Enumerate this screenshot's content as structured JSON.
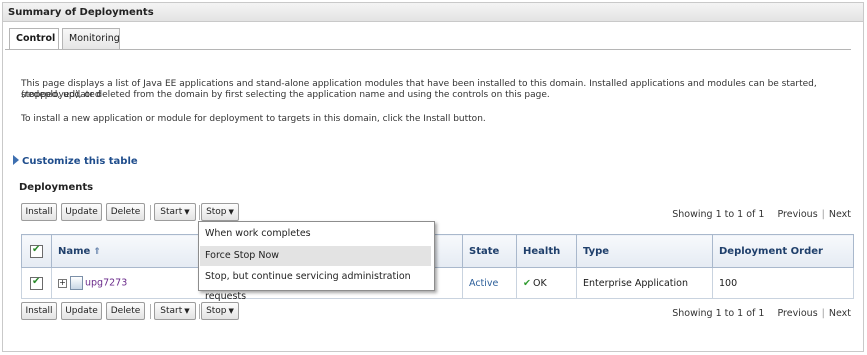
{
  "header": {
    "title": "Summary of Deployments"
  },
  "tabs": [
    {
      "label": "Control"
    },
    {
      "label": "Monitoring"
    }
  ],
  "intro": {
    "line1": "This page displays a list of Java EE applications and stand-alone application modules that have been installed to this domain. Installed applications and modules can be started, stopped, updated",
    "line2": "(redeployed), or deleted from the domain by first selecting the application name and using the controls on this page.",
    "line3": "To install a new application or module for deployment to targets in this domain, click the Install button."
  },
  "customize_label": "Customize this table",
  "section_title": "Deployments",
  "toolbar": {
    "install": "Install",
    "update": "Update",
    "delete": "Delete",
    "start": "Start",
    "stop": "Stop"
  },
  "pager": {
    "summary": "Showing 1 to 1 of 1",
    "previous": "Previous",
    "next": "Next"
  },
  "table": {
    "columns": [
      "Name",
      "State",
      "Health",
      "Type",
      "Deployment Order"
    ],
    "rows": [
      {
        "name": "upg7273",
        "state": "Active",
        "health": "OK",
        "type": "Enterprise Application",
        "order": "100"
      }
    ]
  },
  "stop_menu": {
    "items": [
      "When work completes",
      "Force Stop Now",
      "Stop, but continue servicing administration requests"
    ],
    "highlighted": "Force Stop Now"
  },
  "icons": [
    "expand-triangle-icon",
    "sort-ascending-icon",
    "checkbox-checked-icon",
    "tree-expand-icon",
    "application-icon",
    "ok-checkmark-icon",
    "dropdown-caret-icon"
  ],
  "colors": {
    "link": "#1f4d8c",
    "header_text": "#1f3f6b",
    "ok": "#2f9b2f",
    "active": "#2d5f9a"
  }
}
